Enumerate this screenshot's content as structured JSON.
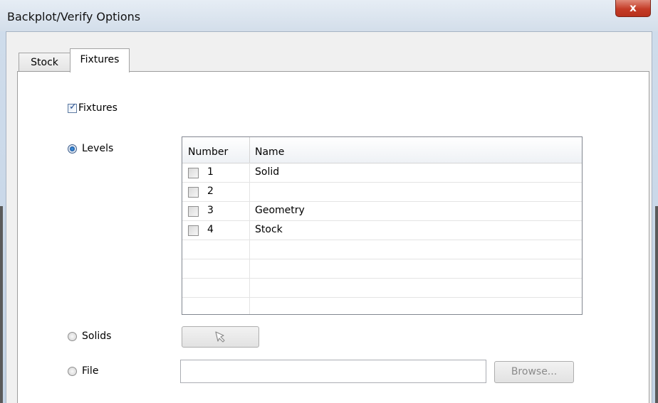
{
  "window": {
    "title": "Backplot/Verify Options",
    "close_label": "x"
  },
  "tabs": [
    {
      "label": "Stock",
      "selected": false
    },
    {
      "label": "Fixtures",
      "selected": true
    }
  ],
  "fixtures_checkbox": {
    "label": "Fixtures",
    "checked": true
  },
  "options": {
    "levels": {
      "label": "Levels",
      "selected": true
    },
    "solids": {
      "label": "Solids",
      "selected": false
    },
    "file": {
      "label": "File",
      "selected": false
    }
  },
  "levels_table": {
    "columns": [
      "Number",
      "Name"
    ],
    "rows": [
      {
        "number": "1",
        "name": "Solid",
        "checked": false
      },
      {
        "number": "2",
        "name": "",
        "checked": false
      },
      {
        "number": "3",
        "name": "Geometry",
        "checked": false
      },
      {
        "number": "4",
        "name": "Stock",
        "checked": false
      }
    ]
  },
  "solids_select_icon": "cursor-arrow-icon",
  "file_input": {
    "value": ""
  },
  "browse_button": {
    "label": "Browse..."
  },
  "colors": {
    "close_button": "#c43c27",
    "radio_selected": "#1d5ea9",
    "check": "#2a4f8f"
  }
}
